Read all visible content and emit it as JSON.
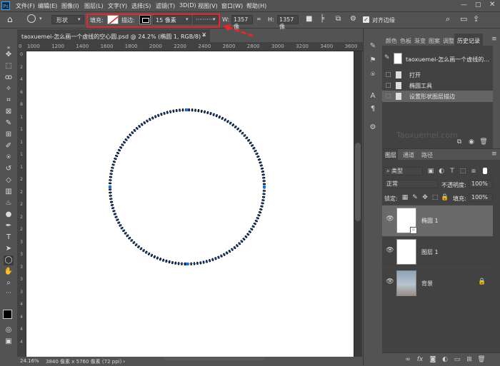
{
  "app": {
    "logo": "Ps"
  },
  "menu": {
    "items": [
      "文件(F)",
      "编辑(E)",
      "图像(I)",
      "图层(L)",
      "文字(Y)",
      "选择(S)",
      "滤镜(T)",
      "3D(D)",
      "视图(V)",
      "窗口(W)",
      "帮助(H)"
    ]
  },
  "options": {
    "shape_mode": "形状",
    "fill_label": "填充:",
    "stroke_label": "描边:",
    "stroke_width": "15 像素",
    "stroke_style": "··········",
    "w_label": "W:",
    "w_value": "1357 像",
    "h_label": "H:",
    "h_value": "1357 像",
    "align_edges_label": "对齐边缘",
    "align_edges_checked": true
  },
  "document": {
    "tab_title": "taoxuemei-怎么画一个虚线的空心圆.psd @ 24.2% (椭圆 1, RGB/8) *",
    "close": "×"
  },
  "ruler": {
    "h_ticks": [
      "0",
      "1000",
      "1200",
      "1400",
      "1600",
      "1800",
      "2000",
      "2200",
      "2400",
      "2600",
      "2800",
      "3000",
      "3200",
      "3400",
      "3600"
    ],
    "v_ticks": [
      "0",
      "2",
      "4",
      "6",
      "8",
      "1",
      "1",
      "1",
      "1",
      "1",
      "2",
      "2",
      "2",
      "2",
      "2",
      "3",
      "3",
      "3",
      "3",
      "3",
      "4",
      "4",
      "4",
      "4"
    ]
  },
  "status": {
    "zoom": "24.16%",
    "doc_info": "3840 像素 x 5760 像素 (72 ppi)"
  },
  "panels": {
    "top_tabs": [
      "颜色",
      "色板",
      "渐变",
      "图案",
      "调整",
      "历史记录"
    ],
    "active_top_tab": "历史记录",
    "history_snapshot": "taoxuemei-怎么画一个虚线的...",
    "history_items": [
      "打开",
      "椭圆工具",
      "设置形状图层描边"
    ],
    "watermark": "Taoxuemei.com",
    "layer_tabs": [
      "图层",
      "通道",
      "路径"
    ],
    "kind_filter": "类型",
    "blend_mode": "正常",
    "opacity_label": "不透明度:",
    "opacity_value": "100%",
    "lock_label": "锁定:",
    "fill_label": "填充:",
    "fill_value": "100%",
    "layers": [
      {
        "name": "椭圆 1",
        "selected": true
      },
      {
        "name": "图层 1",
        "selected": false
      },
      {
        "name": "背景",
        "selected": false,
        "locked": true
      }
    ]
  },
  "colors": {
    "accent_red": "#e8262b",
    "selection_blue": "#1f6fd6"
  }
}
